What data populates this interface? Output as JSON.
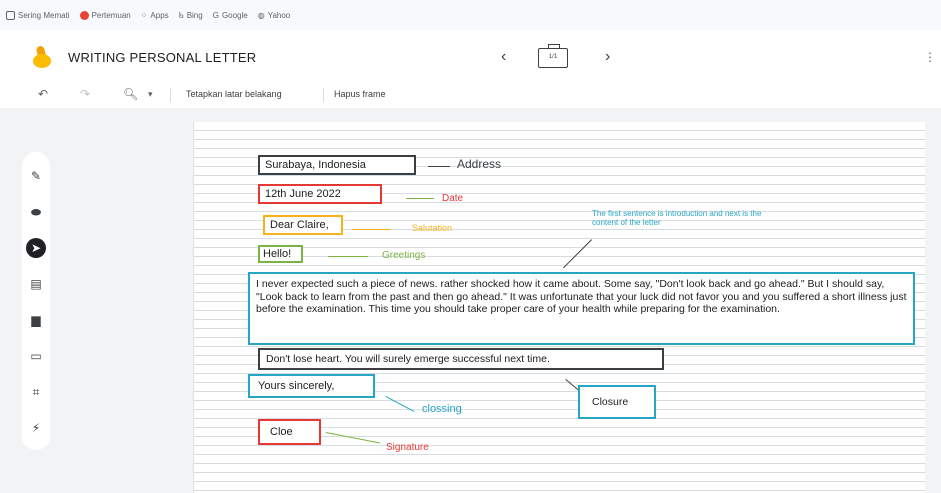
{
  "bookmarks": [
    {
      "label": "Sering Memati",
      "icon": "page-icon",
      "color": "#5f6368"
    },
    {
      "label": "Pertemuan",
      "icon": "circle-icon",
      "color": "#ea4335"
    },
    {
      "label": "Apps",
      "icon": "apps-grid-icon",
      "color": "#5f6368"
    },
    {
      "label": "Bing",
      "icon": "bing-icon",
      "color": "#5f6368"
    },
    {
      "label": "Google",
      "icon": "google-icon",
      "color": "#5f6368"
    },
    {
      "label": "Yahoo",
      "icon": "globe-icon",
      "color": "#5f6368"
    }
  ],
  "header": {
    "title": "WRITING PERSONAL LETTER",
    "frame_counter": "1/1",
    "prev_icon": "chevron-left-icon",
    "next_icon": "chevron-right-icon"
  },
  "toolbar": {
    "undo_icon": "undo-icon",
    "redo_icon": "redo-icon",
    "zoom_icon": "zoom-icon",
    "set_background": "Tetapkan latar belakang",
    "delete_frame": "Hapus frame"
  },
  "sidebar_tools": [
    "pen-icon",
    "eraser-icon",
    "cursor-icon",
    "sticky-note-icon",
    "image-icon",
    "shape-icon",
    "frame-icon",
    "laser-icon"
  ],
  "colors": {
    "address": "#3c4043",
    "date": "#e53935",
    "salutation": "#f6b21a",
    "greeting": "#7cb342",
    "body": "#26a6c4",
    "closing": "#26a6c4",
    "signature": "#e53935"
  },
  "letter": {
    "address": "Surabaya, Indonesia",
    "address_label": "Address",
    "date": "12th June 2022",
    "date_label": "Date",
    "salutation": "Dear Claire,",
    "salutation_label": "Salutation",
    "greeting": "Hello!",
    "greeting_label": "Greetings",
    "intro_note": "The first sentence is introduction and next is the content of the letter",
    "body": "I never expected such a piece of news. rather shocked how it came about. Some say, \"Don't look back and go ahead.\" But I should say, \"Look back to learn from the past and then go ahead.\" It was unfortunate that your luck did not favor you and you suffered a short illness just before the examination. This time you should take proper care of your health while preparing for the examination.",
    "closing_sentence": "Don't lose heart. You will surely emerge successful next time.",
    "closure_label": "Closure",
    "complimentary_close": "Yours sincerely,",
    "closing_label": "clossing",
    "signature": "Cloe",
    "signature_label": "Signature"
  }
}
